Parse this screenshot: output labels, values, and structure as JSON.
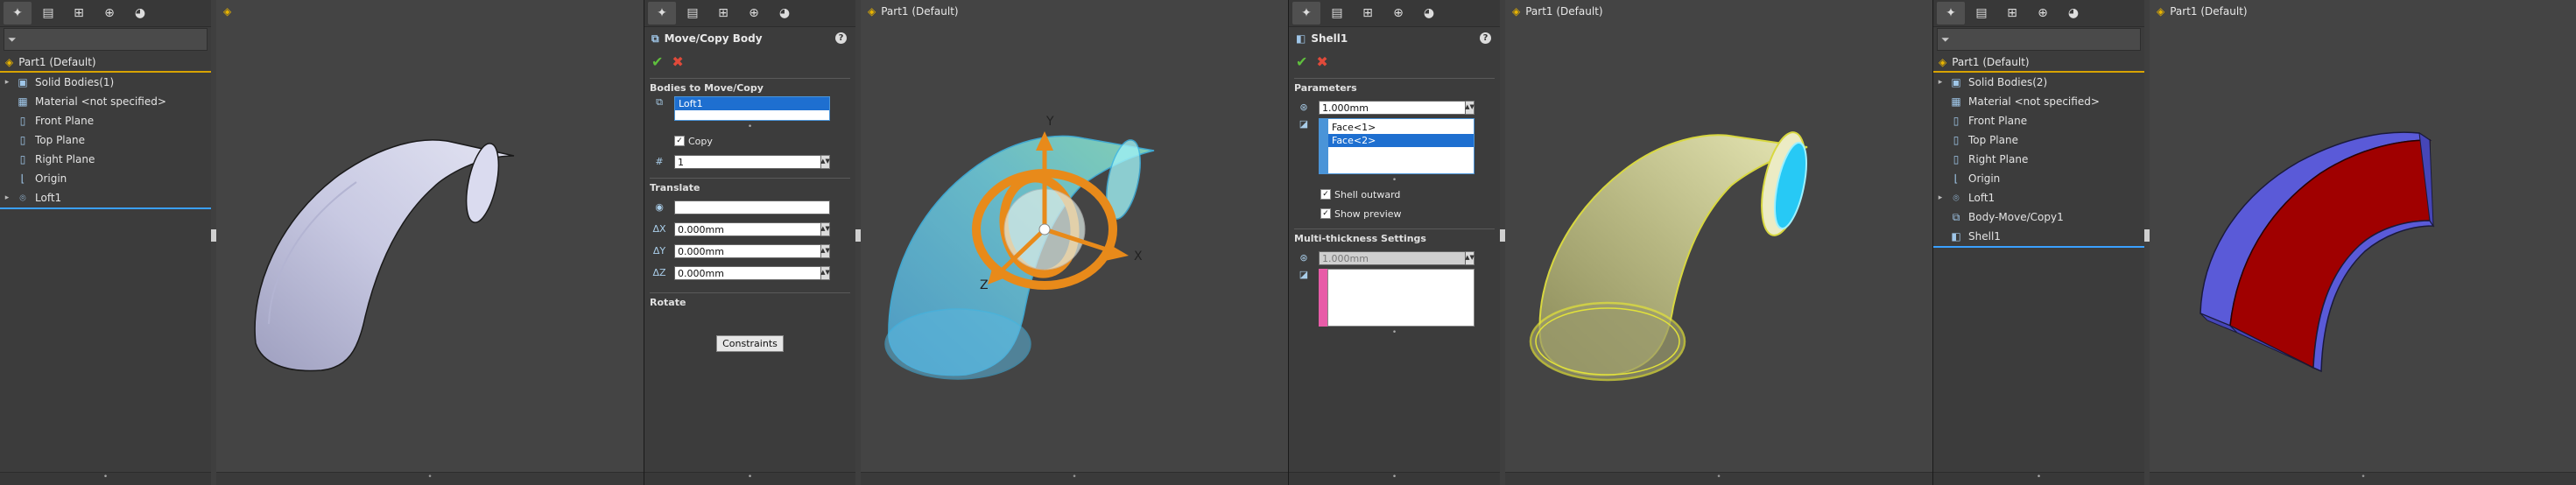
{
  "panel_tabs": [
    "feature-manager-icon",
    "property-manager-icon",
    "configuration-manager-icon",
    "dimxpert-manager-icon",
    "display-manager-icon"
  ],
  "shot1": {
    "viewport_title": "Part1  (Default)",
    "tree": {
      "root": "Part1  (Default)",
      "items": [
        {
          "label": "Solid Bodies(1)",
          "icon": "solid-bodies-icon",
          "expandable": true
        },
        {
          "label": "Material <not specified>",
          "icon": "material-icon",
          "expandable": false
        },
        {
          "label": "Front Plane",
          "icon": "plane-icon",
          "expandable": false
        },
        {
          "label": "Top Plane",
          "icon": "plane-icon",
          "expandable": false
        },
        {
          "label": "Right Plane",
          "icon": "plane-icon",
          "expandable": false
        },
        {
          "label": "Origin",
          "icon": "origin-icon",
          "expandable": false
        },
        {
          "label": "Loft1",
          "icon": "loft-icon",
          "expandable": true
        }
      ]
    }
  },
  "shot2": {
    "viewport_title": "Part1  (Default)",
    "pm_title": "Move/Copy Body",
    "help": "?",
    "bodies_section": "Bodies to Move/Copy",
    "bodies_selected": "Loft1",
    "copy_label": "Copy",
    "copy_count": "1",
    "translate_section": "Translate",
    "dx": "0.000mm",
    "dy": "0.000mm",
    "dz": "0.000mm",
    "rotate_section": "Rotate",
    "constraints_button": "Constraints",
    "triad": {
      "x": "X",
      "y": "Y",
      "z": "Z"
    }
  },
  "shot3": {
    "viewport_title": "Part1  (Default)",
    "pm_title": "Shell1",
    "help": "?",
    "params_section": "Parameters",
    "thickness": "1.000mm",
    "faces": [
      "Face<1>",
      "Face<2>"
    ],
    "shell_outward": "Shell outward",
    "show_preview": "Show preview",
    "multi_section": "Multi-thickness Settings",
    "multi_thickness": "1.000mm"
  },
  "shot4": {
    "viewport_title": "Part1  (Default)",
    "tree": {
      "root": "Part1  (Default)",
      "items": [
        {
          "label": "Solid Bodies(2)",
          "icon": "solid-bodies-icon",
          "expandable": true
        },
        {
          "label": "Material <not specified>",
          "icon": "material-icon",
          "expandable": false
        },
        {
          "label": "Front Plane",
          "icon": "plane-icon",
          "expandable": false
        },
        {
          "label": "Top Plane",
          "icon": "plane-icon",
          "expandable": false
        },
        {
          "label": "Right Plane",
          "icon": "plane-icon",
          "expandable": false
        },
        {
          "label": "Origin",
          "icon": "origin-icon",
          "expandable": false
        },
        {
          "label": "Loft1",
          "icon": "loft-icon",
          "expandable": true
        },
        {
          "label": "Body-Move/Copy1",
          "icon": "move-copy-icon",
          "expandable": false
        },
        {
          "label": "Shell1",
          "icon": "shell-icon",
          "expandable": false
        }
      ]
    }
  },
  "colors": {
    "accent_selection": "#1e6fd0",
    "tree_root_underline": "#d8a300",
    "ok": "#5fbf3d",
    "cancel": "#e04a3a",
    "shell_red": "#a00000",
    "shell_edge": "#5a5ad8"
  }
}
